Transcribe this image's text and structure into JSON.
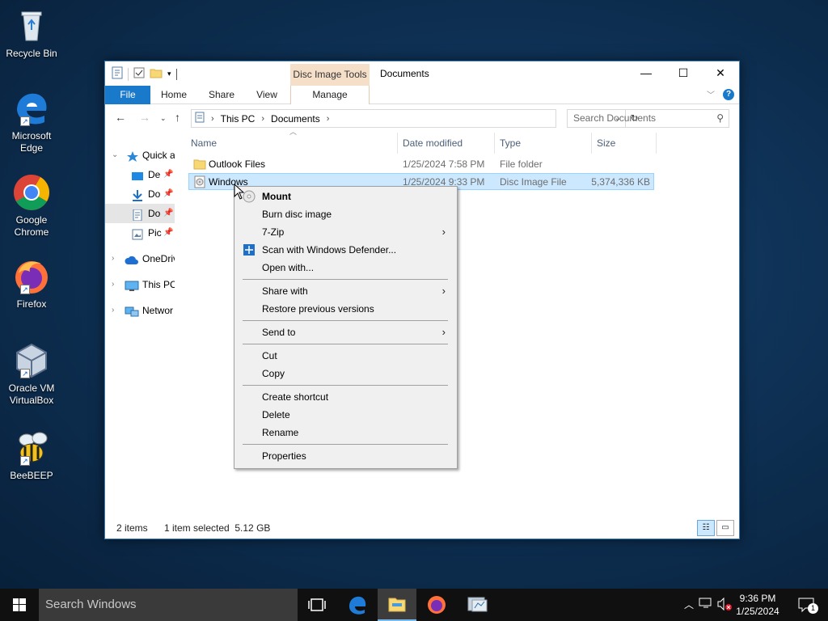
{
  "desktop": {
    "icons": [
      {
        "label": "Recycle Bin"
      },
      {
        "label": "Microsoft Edge"
      },
      {
        "label": "Google Chrome"
      },
      {
        "label": "Firefox"
      },
      {
        "label": "Oracle VM VirtualBox"
      },
      {
        "label": "BeeBEEP"
      }
    ]
  },
  "window": {
    "title": "Documents",
    "contextual_tab_group": "Disc Image Tools",
    "ribbon_tabs": [
      "File",
      "Home",
      "Share",
      "View",
      "Manage"
    ],
    "controls": {
      "minimize": "—",
      "maximize": "☐",
      "close": "✕"
    },
    "address": {
      "crumbs": [
        "This PC",
        "Documents"
      ]
    },
    "search": {
      "placeholder": "Search Documents"
    },
    "nav": [
      {
        "label": "Quick a"
      },
      {
        "label": "De"
      },
      {
        "label": "Do"
      },
      {
        "label": "Do"
      },
      {
        "label": "Pic"
      },
      {
        "label": "OneDriv"
      },
      {
        "label": "This PC"
      },
      {
        "label": "Networ"
      }
    ],
    "columns": [
      "Name",
      "Date modified",
      "Type",
      "Size"
    ],
    "files": [
      {
        "name": "Outlook Files",
        "date": "1/25/2024 7:58 PM",
        "type": "File folder",
        "size": ""
      },
      {
        "name": "Windows",
        "date": "1/25/2024 9:33 PM",
        "type": "Disc Image File",
        "size": "5,374,336 KB"
      }
    ],
    "status": {
      "count": "2 items",
      "selection": "1 item selected  5.12 GB"
    }
  },
  "context_menu": {
    "items": [
      {
        "label": "Mount"
      },
      {
        "label": "Burn disc image"
      },
      {
        "label": "7-Zip"
      },
      {
        "label": "Scan with Windows Defender..."
      },
      {
        "label": "Open with..."
      },
      {
        "label": "Share with"
      },
      {
        "label": "Restore previous versions"
      },
      {
        "label": "Send to"
      },
      {
        "label": "Cut"
      },
      {
        "label": "Copy"
      },
      {
        "label": "Create shortcut"
      },
      {
        "label": "Delete"
      },
      {
        "label": "Rename"
      },
      {
        "label": "Properties"
      }
    ]
  },
  "taskbar": {
    "search_placeholder": "Search Windows",
    "time": "9:36 PM",
    "date": "1/25/2024",
    "notification_count": "1"
  }
}
